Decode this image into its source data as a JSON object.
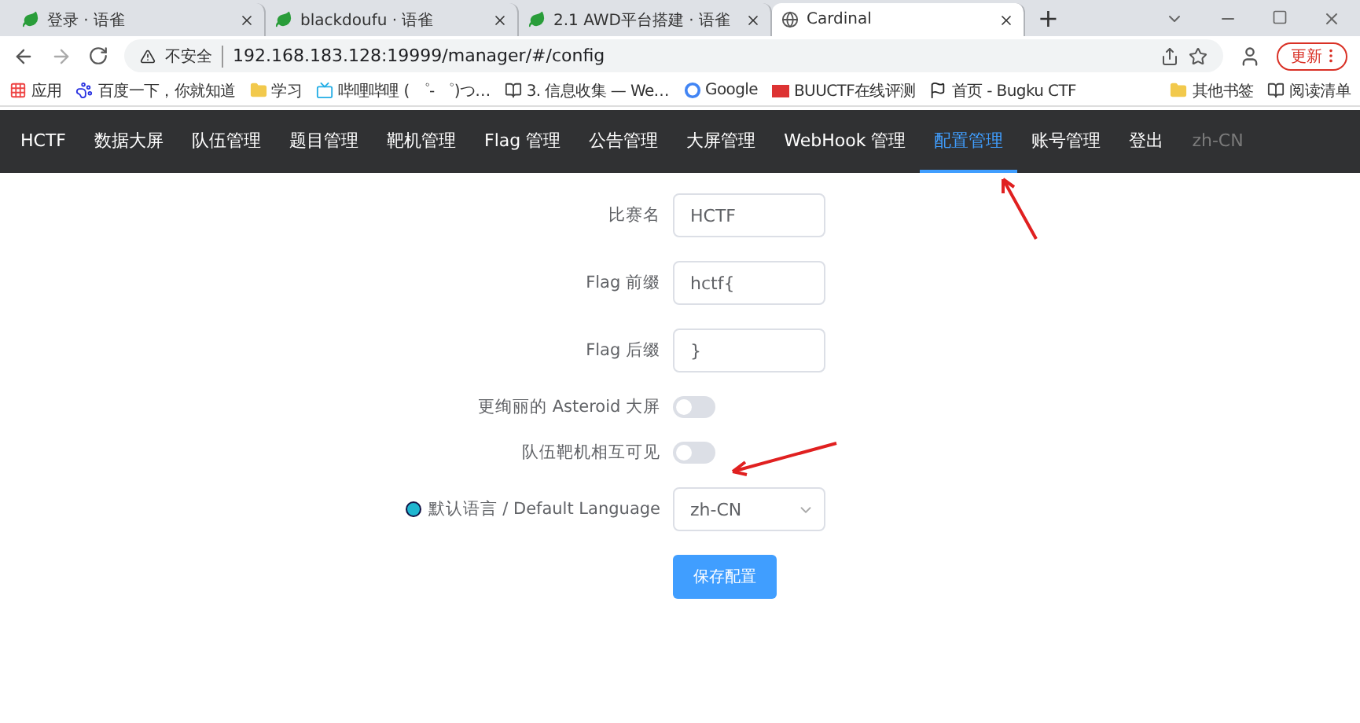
{
  "browser_tabs": [
    {
      "title": "登录 · 语雀",
      "selected": false
    },
    {
      "title": "blackdoufu · 语雀",
      "selected": false
    },
    {
      "title": "2.1 AWD平台搭建 · 语雀",
      "selected": false
    },
    {
      "title": "Cardinal",
      "selected": true
    }
  ],
  "new_tab": "+",
  "address_bar": {
    "security": "不安全",
    "url": "192.168.183.128:19999/manager/#/config"
  },
  "update_button": "更新",
  "bookmarks": [
    {
      "label": "应用"
    },
    {
      "label": "百度一下，你就知道"
    },
    {
      "label": "学习"
    },
    {
      "label": "哔哩哔哩 ( ゜- ゜)つ…"
    },
    {
      "label": "3. 信息收集 — We…"
    },
    {
      "label": "Google"
    },
    {
      "label": "BUUCTF在线评测"
    },
    {
      "label": "首页 - Bugku CTF"
    }
  ],
  "bookmarks_right": [
    {
      "label": "其他书签"
    },
    {
      "label": "阅读清单"
    }
  ],
  "nav": {
    "items": [
      {
        "label": "HCTF",
        "selected": false,
        "disabled": false
      },
      {
        "label": "数据大屏",
        "selected": false,
        "disabled": false
      },
      {
        "label": "队伍管理",
        "selected": false,
        "disabled": false
      },
      {
        "label": "题目管理",
        "selected": false,
        "disabled": false
      },
      {
        "label": "靶机管理",
        "selected": false,
        "disabled": false
      },
      {
        "label": "Flag 管理",
        "selected": false,
        "disabled": false
      },
      {
        "label": "公告管理",
        "selected": false,
        "disabled": false
      },
      {
        "label": "大屏管理",
        "selected": false,
        "disabled": false
      },
      {
        "label": "WebHook 管理",
        "selected": false,
        "disabled": false
      },
      {
        "label": "配置管理",
        "selected": true,
        "disabled": false
      },
      {
        "label": "账号管理",
        "selected": false,
        "disabled": false
      },
      {
        "label": "登出",
        "selected": false,
        "disabled": false
      },
      {
        "label": "zh-CN",
        "selected": false,
        "disabled": true
      }
    ]
  },
  "form": {
    "rows": [
      {
        "kind": "input",
        "label": "比赛名",
        "value": "HCTF"
      },
      {
        "kind": "input",
        "label": "Flag 前缀",
        "value": "hctf{"
      },
      {
        "kind": "input",
        "label": "Flag 后缀",
        "value": "}"
      },
      {
        "kind": "switch",
        "label": "更绚丽的 Asteroid 大屏",
        "on": false
      },
      {
        "kind": "switch",
        "label": "队伍靶机相互可见",
        "on": false
      },
      {
        "kind": "select",
        "label": "默认语言 / Default Language",
        "value": "zh-CN"
      }
    ],
    "save_button": "保存配置"
  }
}
